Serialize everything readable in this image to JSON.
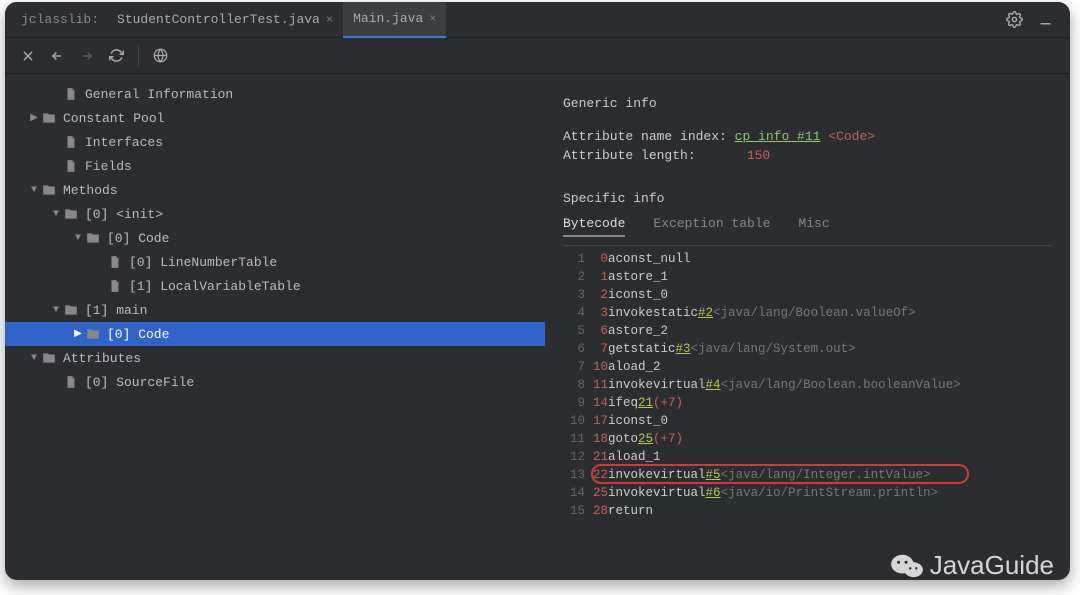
{
  "titlebar": {
    "project": "jclasslib:",
    "tabs": [
      {
        "label": "StudentControllerTest.java",
        "active": false
      },
      {
        "label": "Main.java",
        "active": true
      }
    ]
  },
  "tree": [
    {
      "indent": 2,
      "chevron": "",
      "icon": "file",
      "label": "General Information",
      "selected": false
    },
    {
      "indent": 1,
      "chevron": "right",
      "icon": "folder",
      "label": "Constant Pool",
      "selected": false
    },
    {
      "indent": 2,
      "chevron": "",
      "icon": "file",
      "label": "Interfaces",
      "selected": false
    },
    {
      "indent": 2,
      "chevron": "",
      "icon": "file",
      "label": "Fields",
      "selected": false
    },
    {
      "indent": 1,
      "chevron": "down",
      "icon": "folder",
      "label": "Methods",
      "selected": false
    },
    {
      "indent": 2,
      "chevron": "down",
      "icon": "folder",
      "label": "[0] <init>",
      "selected": false
    },
    {
      "indent": 3,
      "chevron": "down",
      "icon": "folder",
      "label": "[0] Code",
      "selected": false
    },
    {
      "indent": 4,
      "chevron": "",
      "icon": "file",
      "label": "[0] LineNumberTable",
      "selected": false
    },
    {
      "indent": 4,
      "chevron": "",
      "icon": "file",
      "label": "[1] LocalVariableTable",
      "selected": false
    },
    {
      "indent": 2,
      "chevron": "down",
      "icon": "folder",
      "label": "[1] main",
      "selected": false
    },
    {
      "indent": 3,
      "chevron": "right",
      "icon": "folder",
      "label": "[0] Code",
      "selected": true
    },
    {
      "indent": 1,
      "chevron": "down",
      "icon": "folder",
      "label": "Attributes",
      "selected": false
    },
    {
      "indent": 2,
      "chevron": "",
      "icon": "file",
      "label": "[0] SourceFile",
      "selected": false
    }
  ],
  "generic": {
    "title": "Generic info",
    "name_index_label": "Attribute name index:",
    "name_index_link": "cp_info #11",
    "name_index_value": "<Code>",
    "length_label": "Attribute length:",
    "length_value": "150"
  },
  "specific": {
    "title": "Specific info",
    "tabs": [
      "Bytecode",
      "Exception table",
      "Misc"
    ],
    "selected_tab": "Bytecode"
  },
  "bytecode": [
    {
      "ln": 1,
      "pc": "0",
      "op": "aconst_null"
    },
    {
      "ln": 2,
      "pc": "1",
      "op": "astore_1"
    },
    {
      "ln": 3,
      "pc": "2",
      "op": "iconst_0"
    },
    {
      "ln": 4,
      "pc": "3",
      "op": "invokestatic",
      "ref": "#2",
      "cmt": "<java/lang/Boolean.valueOf>"
    },
    {
      "ln": 5,
      "pc": "6",
      "op": "astore_2"
    },
    {
      "ln": 6,
      "pc": "7",
      "op": "getstatic",
      "ref": "#3",
      "cmt": "<java/lang/System.out>"
    },
    {
      "ln": 7,
      "pc": "10",
      "op": "aload_2"
    },
    {
      "ln": 8,
      "pc": "11",
      "op": "invokevirtual",
      "ref": "#4",
      "cmt": "<java/lang/Boolean.booleanValue>"
    },
    {
      "ln": 9,
      "pc": "14",
      "op": "ifeq",
      "jmp": "21",
      "jmpoff": "(+7)"
    },
    {
      "ln": 10,
      "pc": "17",
      "op": "iconst_0"
    },
    {
      "ln": 11,
      "pc": "18",
      "op": "goto",
      "jmp": "25",
      "jmpoff": "(+7)"
    },
    {
      "ln": 12,
      "pc": "21",
      "op": "aload_1"
    },
    {
      "ln": 13,
      "pc": "22",
      "op": "invokevirtual",
      "ref": "#5",
      "cmt": "<java/lang/Integer.intValue>",
      "highlight": true
    },
    {
      "ln": 14,
      "pc": "25",
      "op": "invokevirtual",
      "ref": "#6",
      "cmt": "<java/io/PrintStream.println>"
    },
    {
      "ln": 15,
      "pc": "28",
      "op": "return"
    }
  ],
  "watermark": "JavaGuide"
}
